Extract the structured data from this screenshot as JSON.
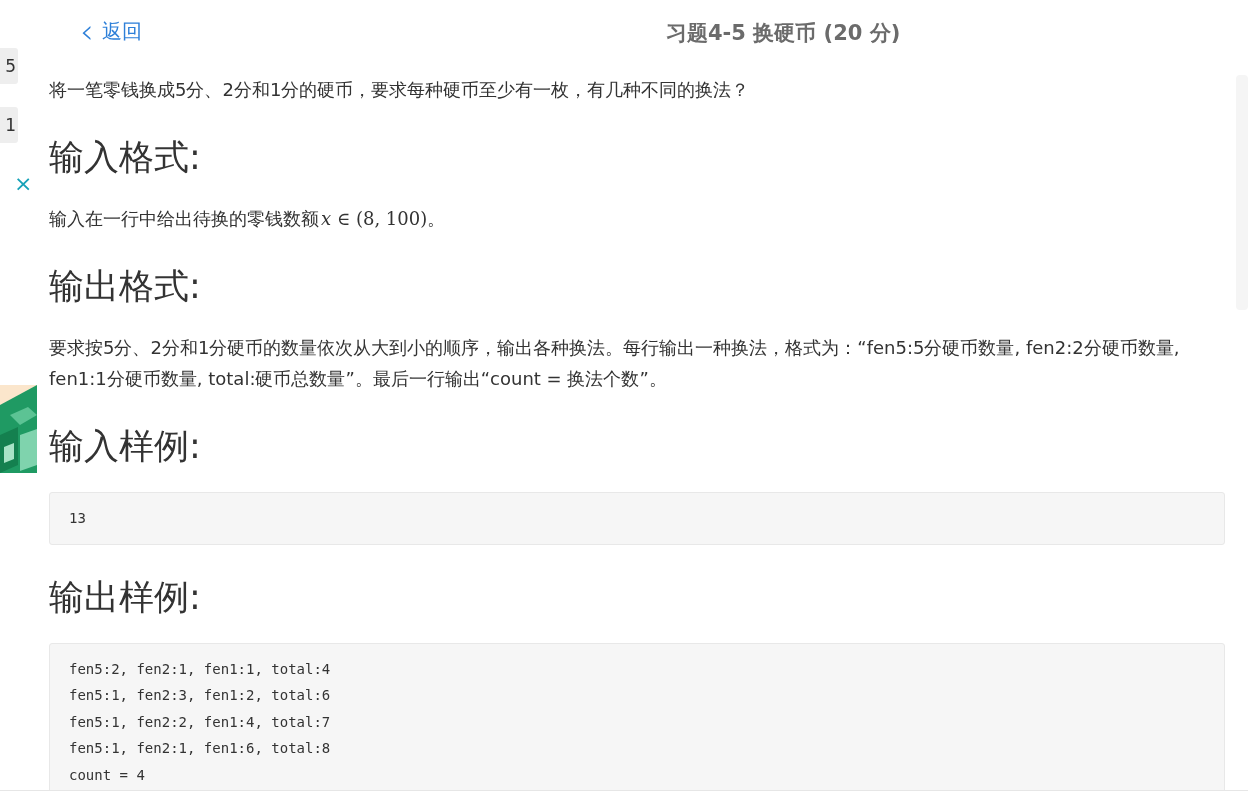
{
  "side_fragments": {
    "page_buttons": [
      "5",
      "1"
    ],
    "ad_close": {
      "close": "×"
    }
  },
  "header": {
    "back": {
      "icon": "‹",
      "label": "返回"
    },
    "title": "习题4-5 换硬币 (20 分)"
  },
  "intro": "将一笔零钱换成5分、2分和1分的硬币，要求每种硬币至少有一枚，有几种不同的换法？",
  "sections": [
    {
      "heading": "输入格式:",
      "kind": "text",
      "text": "输入在一行中给出待换的零钱数额",
      "variable": "x",
      "math": "∈ (8, 100)",
      "after": "。"
    },
    {
      "heading": "输出格式:",
      "kind": "text",
      "text": "要求按5分、2分和1分硬币的数量依次从大到小的顺序，输出各种换法。每行输出一种换法，格式为：“fen5:5分硬币数量, fen2:2分硬币数量, fen1:1分硬币数量, total:硬币总数量”。最后一行输出“count = 换法个数”。"
    },
    {
      "heading": "输入样例:",
      "kind": "code",
      "lines": [
        "13"
      ]
    },
    {
      "heading": "输出样例:",
      "kind": "code",
      "lines": [
        "fen5:2, fen2:1, fen1:1, total:4",
        "fen5:1, fen2:3, fen1:2, total:6",
        "fen5:1, fen2:2, fen1:4, total:7",
        "fen5:1, fen2:1, fen1:6, total:8",
        "count = 4"
      ]
    }
  ]
}
